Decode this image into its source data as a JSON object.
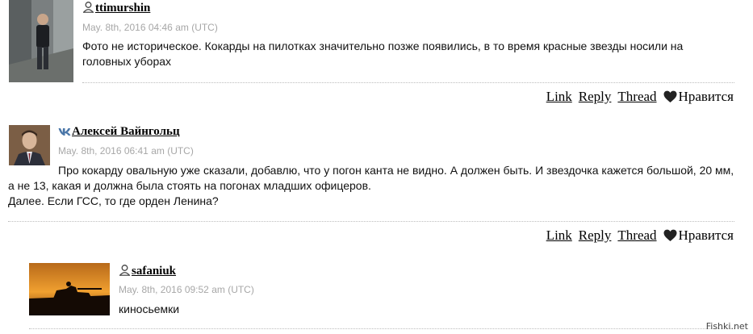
{
  "comments": [
    {
      "username": "ttimurshin",
      "icon": "user-icon",
      "date": "May. 8th, 2016 04:46 am (UTC)",
      "lines": [
        "Фото не историческое. Кокарды на пилотках значительно позже появились, в то время красные звезды носили на головных уборах"
      ]
    },
    {
      "username": "Алексей Вайнгольц",
      "icon": "vk-icon",
      "date": "May. 8th, 2016 06:41 am (UTC)",
      "lines": [
        "Про кокарду овальную уже сказали, добавлю, что у погон канта не видно. А должен быть. И звездочка кажется большой, 20 мм, а не 13, какая и должна была стоять на погонах младших офицеров.",
        "Далее. Если ГСС, то где орден Ленина?"
      ]
    },
    {
      "username": "safaniuk",
      "icon": "user-icon",
      "date": "May. 8th, 2016 09:52 am (UTC)",
      "lines": [
        "киносьемки"
      ]
    }
  ],
  "actions": {
    "link": "Link",
    "reply": "Reply",
    "thread": "Thread",
    "like": "Нравится"
  },
  "watermark": "Fishki.net"
}
